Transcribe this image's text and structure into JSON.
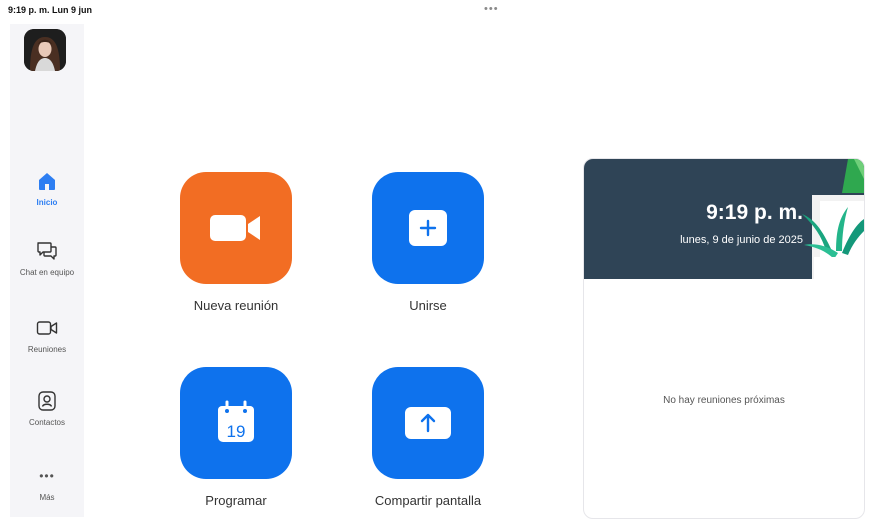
{
  "status_bar": {
    "time": "9:19 p. m.   Lun 9 jun"
  },
  "top_menu": {
    "dots": "•••"
  },
  "sidebar": {
    "items": [
      {
        "label": "Inicio",
        "icon": "home-icon",
        "active": true
      },
      {
        "label": "Chat en equipo",
        "icon": "chat-icon",
        "active": false
      },
      {
        "label": "Reuniones",
        "icon": "video-icon",
        "active": false
      },
      {
        "label": "Contactos",
        "icon": "contacts-icon",
        "active": false
      },
      {
        "label": "Más",
        "icon": "more-icon",
        "active": false
      }
    ],
    "more_dots": "•••"
  },
  "actions": [
    {
      "label": "Nueva reunión",
      "icon": "video-camera-icon",
      "color": "#f26d23"
    },
    {
      "label": "Unirse",
      "icon": "plus-icon",
      "color": "#0e72ed"
    },
    {
      "label": "Programar",
      "icon": "calendar-icon",
      "calendar_day": "19",
      "color": "#0e72ed"
    },
    {
      "label": "Compartir pantalla",
      "icon": "share-arrow-up-icon",
      "color": "#0e72ed"
    }
  ],
  "schedule_card": {
    "time": "9:19 p. m.",
    "date": "lunes, 9 de junio de 2025",
    "empty_text": "No hay reuniones próximas"
  },
  "colors": {
    "accent_blue": "#0e72ed",
    "accent_orange": "#f26d23",
    "active_nav": "#2d7ef2",
    "card_header": "#2f4456"
  }
}
